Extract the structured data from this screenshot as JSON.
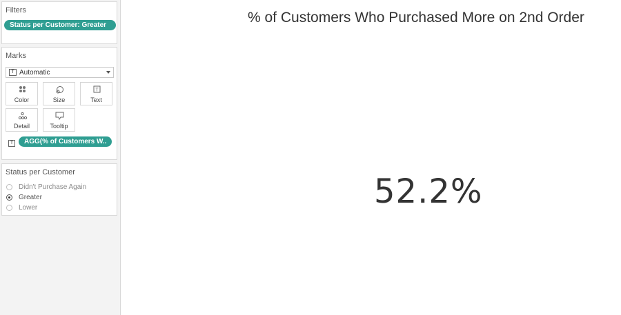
{
  "filters": {
    "title": "Filters",
    "pill": "Status per Customer: Greater"
  },
  "marks": {
    "title": "Marks",
    "mark_type": "Automatic",
    "buttons": [
      {
        "label": "Color",
        "icon": "color-icon"
      },
      {
        "label": "Size",
        "icon": "size-icon"
      },
      {
        "label": "Text",
        "icon": "text-icon"
      },
      {
        "label": "Detail",
        "icon": "detail-icon"
      },
      {
        "label": "Tooltip",
        "icon": "tooltip-icon"
      }
    ],
    "field_pill": "AGG(% of Customers W..",
    "field_pill_color": "#2f9e92"
  },
  "status_filter": {
    "title": "Status per Customer",
    "options": [
      {
        "label": "Didn't Purchase Again",
        "selected": false
      },
      {
        "label": "Greater",
        "selected": true
      },
      {
        "label": "Lower",
        "selected": false
      }
    ]
  },
  "viz": {
    "title": "% of Customers Who Purchased More on 2nd Order",
    "value": "52.2%"
  }
}
